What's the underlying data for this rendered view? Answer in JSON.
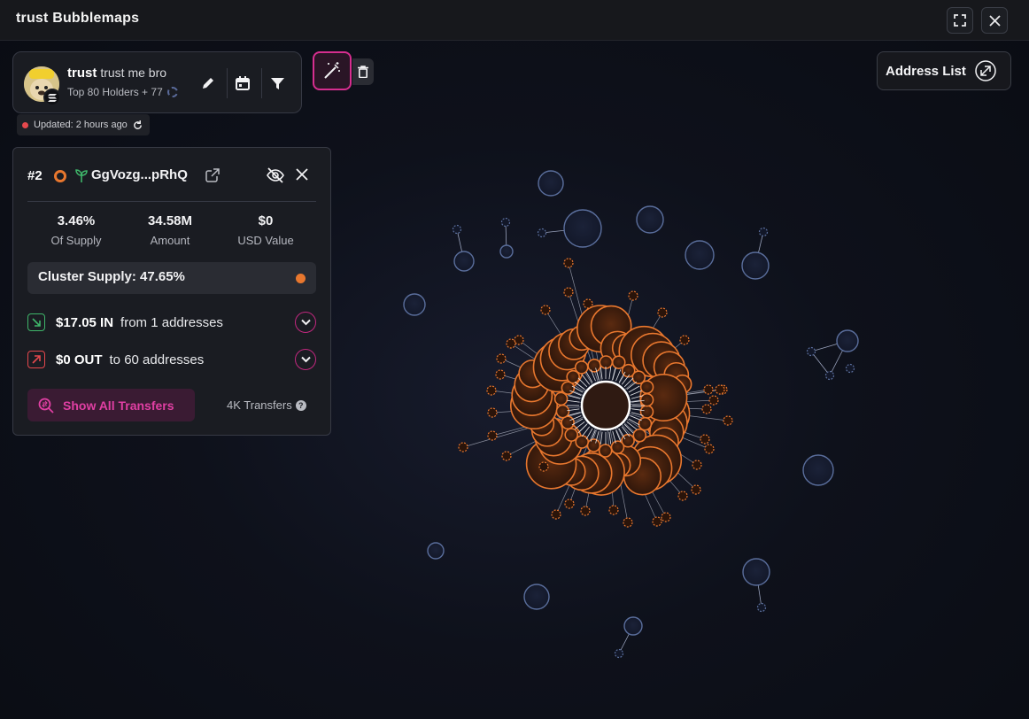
{
  "window": {
    "title": "trust Bubblemaps"
  },
  "icons": {
    "fullscreen": "fullscreen-icon",
    "close": "close-icon",
    "edit": "pencil-icon",
    "calendar": "calendar-icon",
    "filter": "filter-icon",
    "magic": "magic-wand-icon",
    "trash": "trash-icon",
    "external": "external-link-icon",
    "hide": "eye-off-icon",
    "refresh": "refresh-icon"
  },
  "token": {
    "symbol": "trust",
    "name": "trust me bro",
    "holders": "Top 80 Holders + 77",
    "updated": "Updated: 2 hours ago"
  },
  "address_list": {
    "label": "Address List"
  },
  "detail": {
    "rank": "#2",
    "address": "GgVozg...pRhQ",
    "stats": [
      {
        "value": "3.46%",
        "label": "Of Supply"
      },
      {
        "value": "34.58M",
        "label": "Amount"
      },
      {
        "value": "$0",
        "label": "USD Value"
      }
    ],
    "cluster_supply": "Cluster Supply: 47.65%",
    "in": {
      "amount": "$17.05 IN",
      "text": "from 1 addresses"
    },
    "out": {
      "amount": "$0 OUT",
      "text": "to 60 addresses"
    },
    "show_all": "Show All Transfers",
    "transfers": "4K Transfers"
  },
  "colors": {
    "accent_pink": "#d62e8f",
    "cluster_orange": "#e8772e",
    "bubble_blue": "#5a6e9c",
    "in_green": "#3fb56a",
    "out_red": "#e5484d"
  }
}
